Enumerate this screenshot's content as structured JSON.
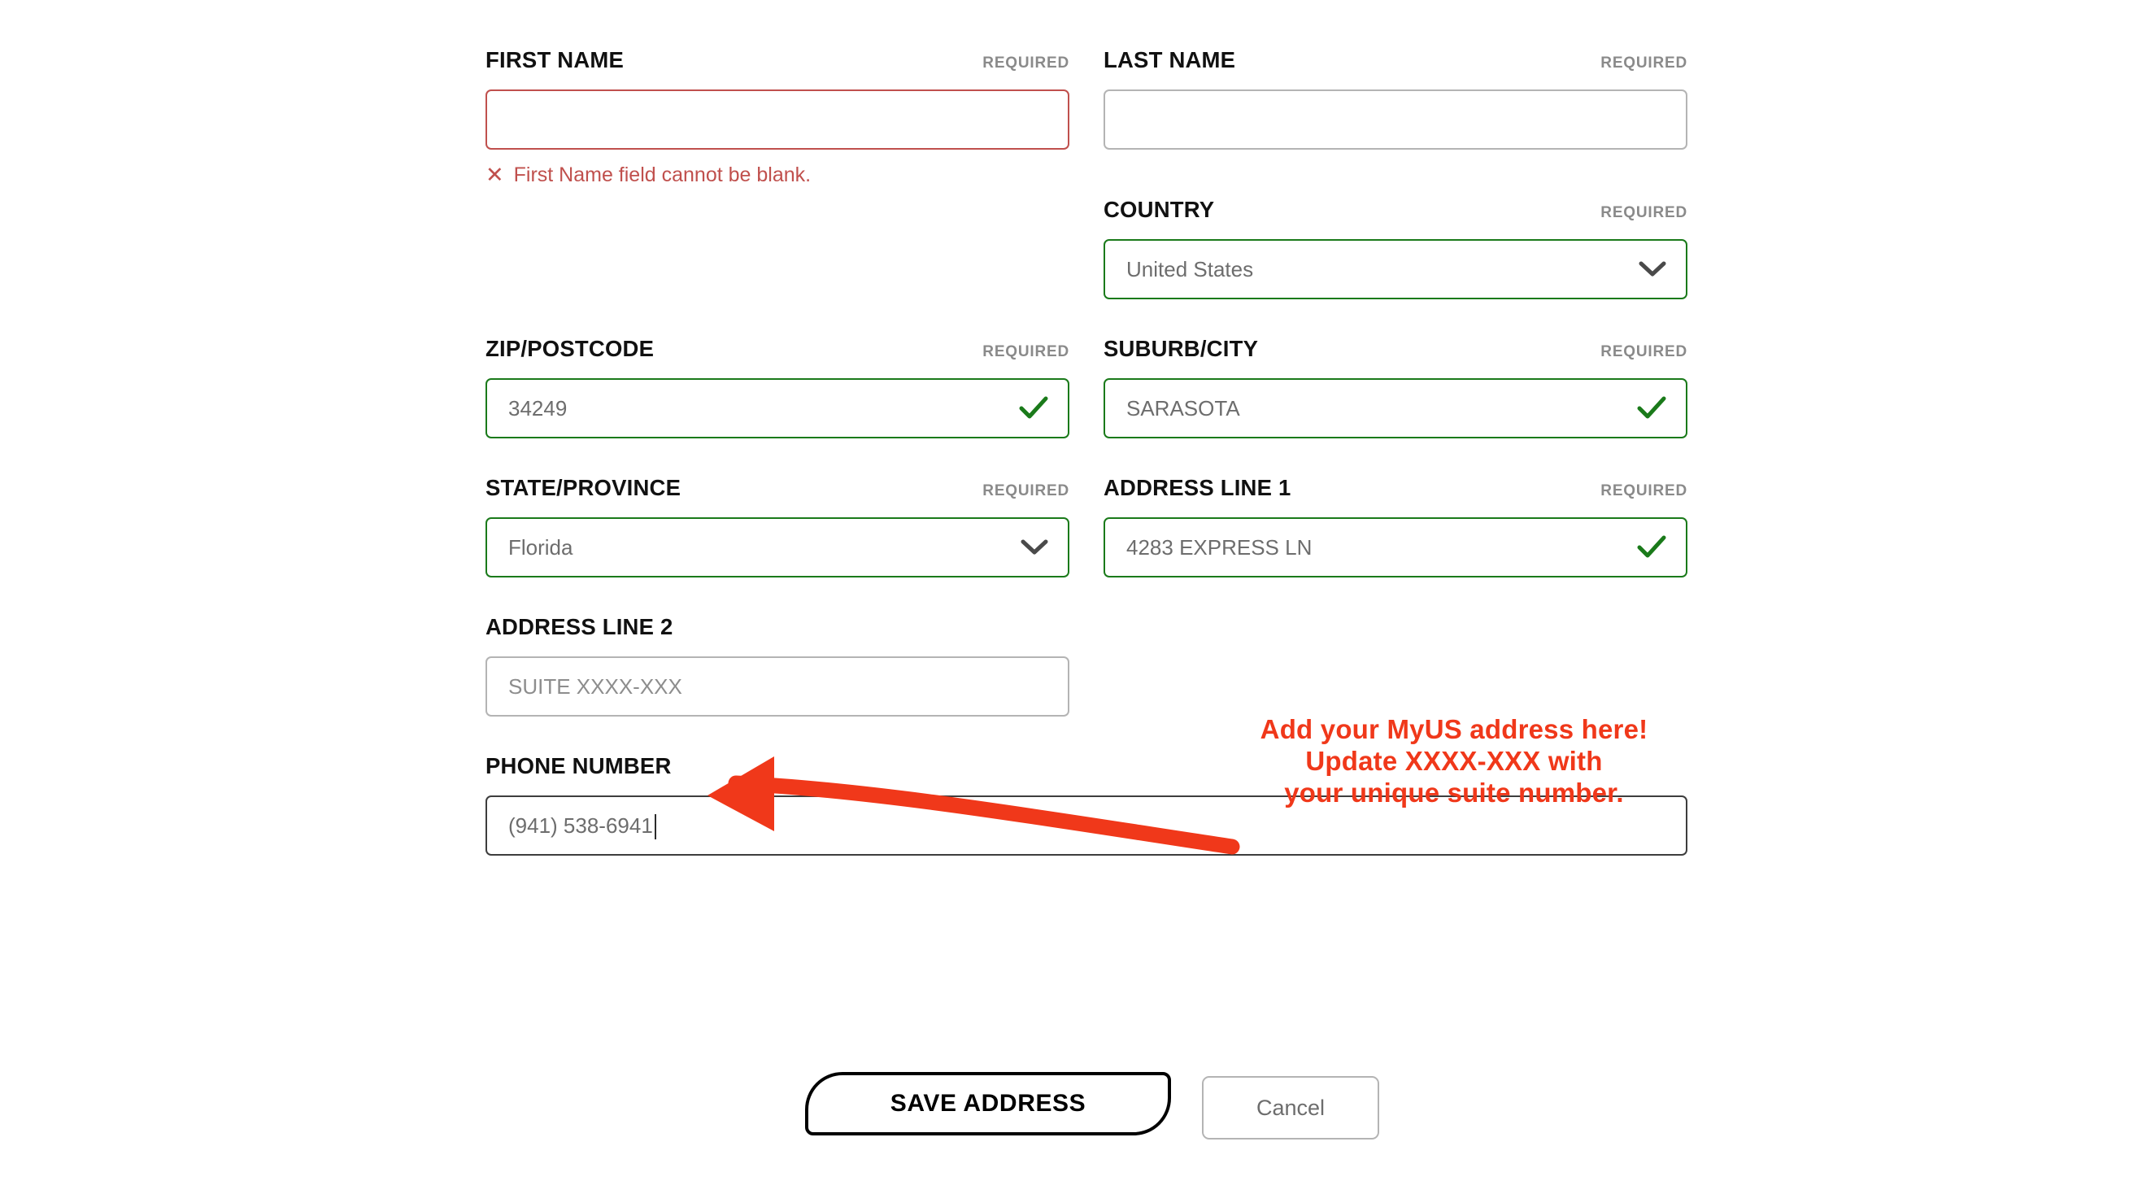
{
  "meta": {
    "required_label": "REQUIRED"
  },
  "fields": {
    "first_name": {
      "label": "FIRST NAME",
      "required": "REQUIRED",
      "value": "",
      "state": "error",
      "error": "First Name field cannot be blank.",
      "error_icon": "close-x-icon"
    },
    "last_name": {
      "label": "LAST NAME",
      "required": "REQUIRED",
      "value": "",
      "state": "default"
    },
    "country": {
      "label": "COUNTRY",
      "required": "REQUIRED",
      "value": "United States",
      "state": "valid",
      "icon": "chevron-down-icon"
    },
    "zip": {
      "label": "ZIP/POSTCODE",
      "required": "REQUIRED",
      "value": "34249",
      "state": "valid",
      "icon": "check-icon"
    },
    "city": {
      "label": "SUBURB/CITY",
      "required": "REQUIRED",
      "value": "SARASOTA",
      "state": "valid",
      "icon": "check-icon"
    },
    "state_province": {
      "label": "STATE/PROVINCE",
      "required": "REQUIRED",
      "value": "Florida",
      "state": "valid",
      "icon": "chevron-down-icon"
    },
    "address_line_1": {
      "label": "ADDRESS LINE 1",
      "required": "REQUIRED",
      "value": "4283 EXPRESS LN",
      "state": "valid",
      "icon": "check-icon"
    },
    "address_line_2": {
      "label": "ADDRESS LINE 2",
      "required": "",
      "placeholder": "SUITE XXXX-XXX",
      "value": "",
      "state": "default"
    },
    "phone": {
      "label": "PHONE NUMBER",
      "required": "",
      "value": "(941) 538-6941",
      "state": "focused"
    }
  },
  "annotation": {
    "line1": "Add your MyUS address here!",
    "line2": "Update XXXX-XXX with",
    "line3": "your unique suite number.",
    "color": "#F0381A",
    "arrow": "curved-arrow-pointing-left"
  },
  "actions": {
    "save_label": "SAVE ADDRESS",
    "cancel_label": "Cancel"
  },
  "colors": {
    "error": "#c0504d",
    "valid": "#1a7a1a",
    "annotation": "#F0381A",
    "focus": "#3d3d3d",
    "border": "#b4b4b4"
  }
}
